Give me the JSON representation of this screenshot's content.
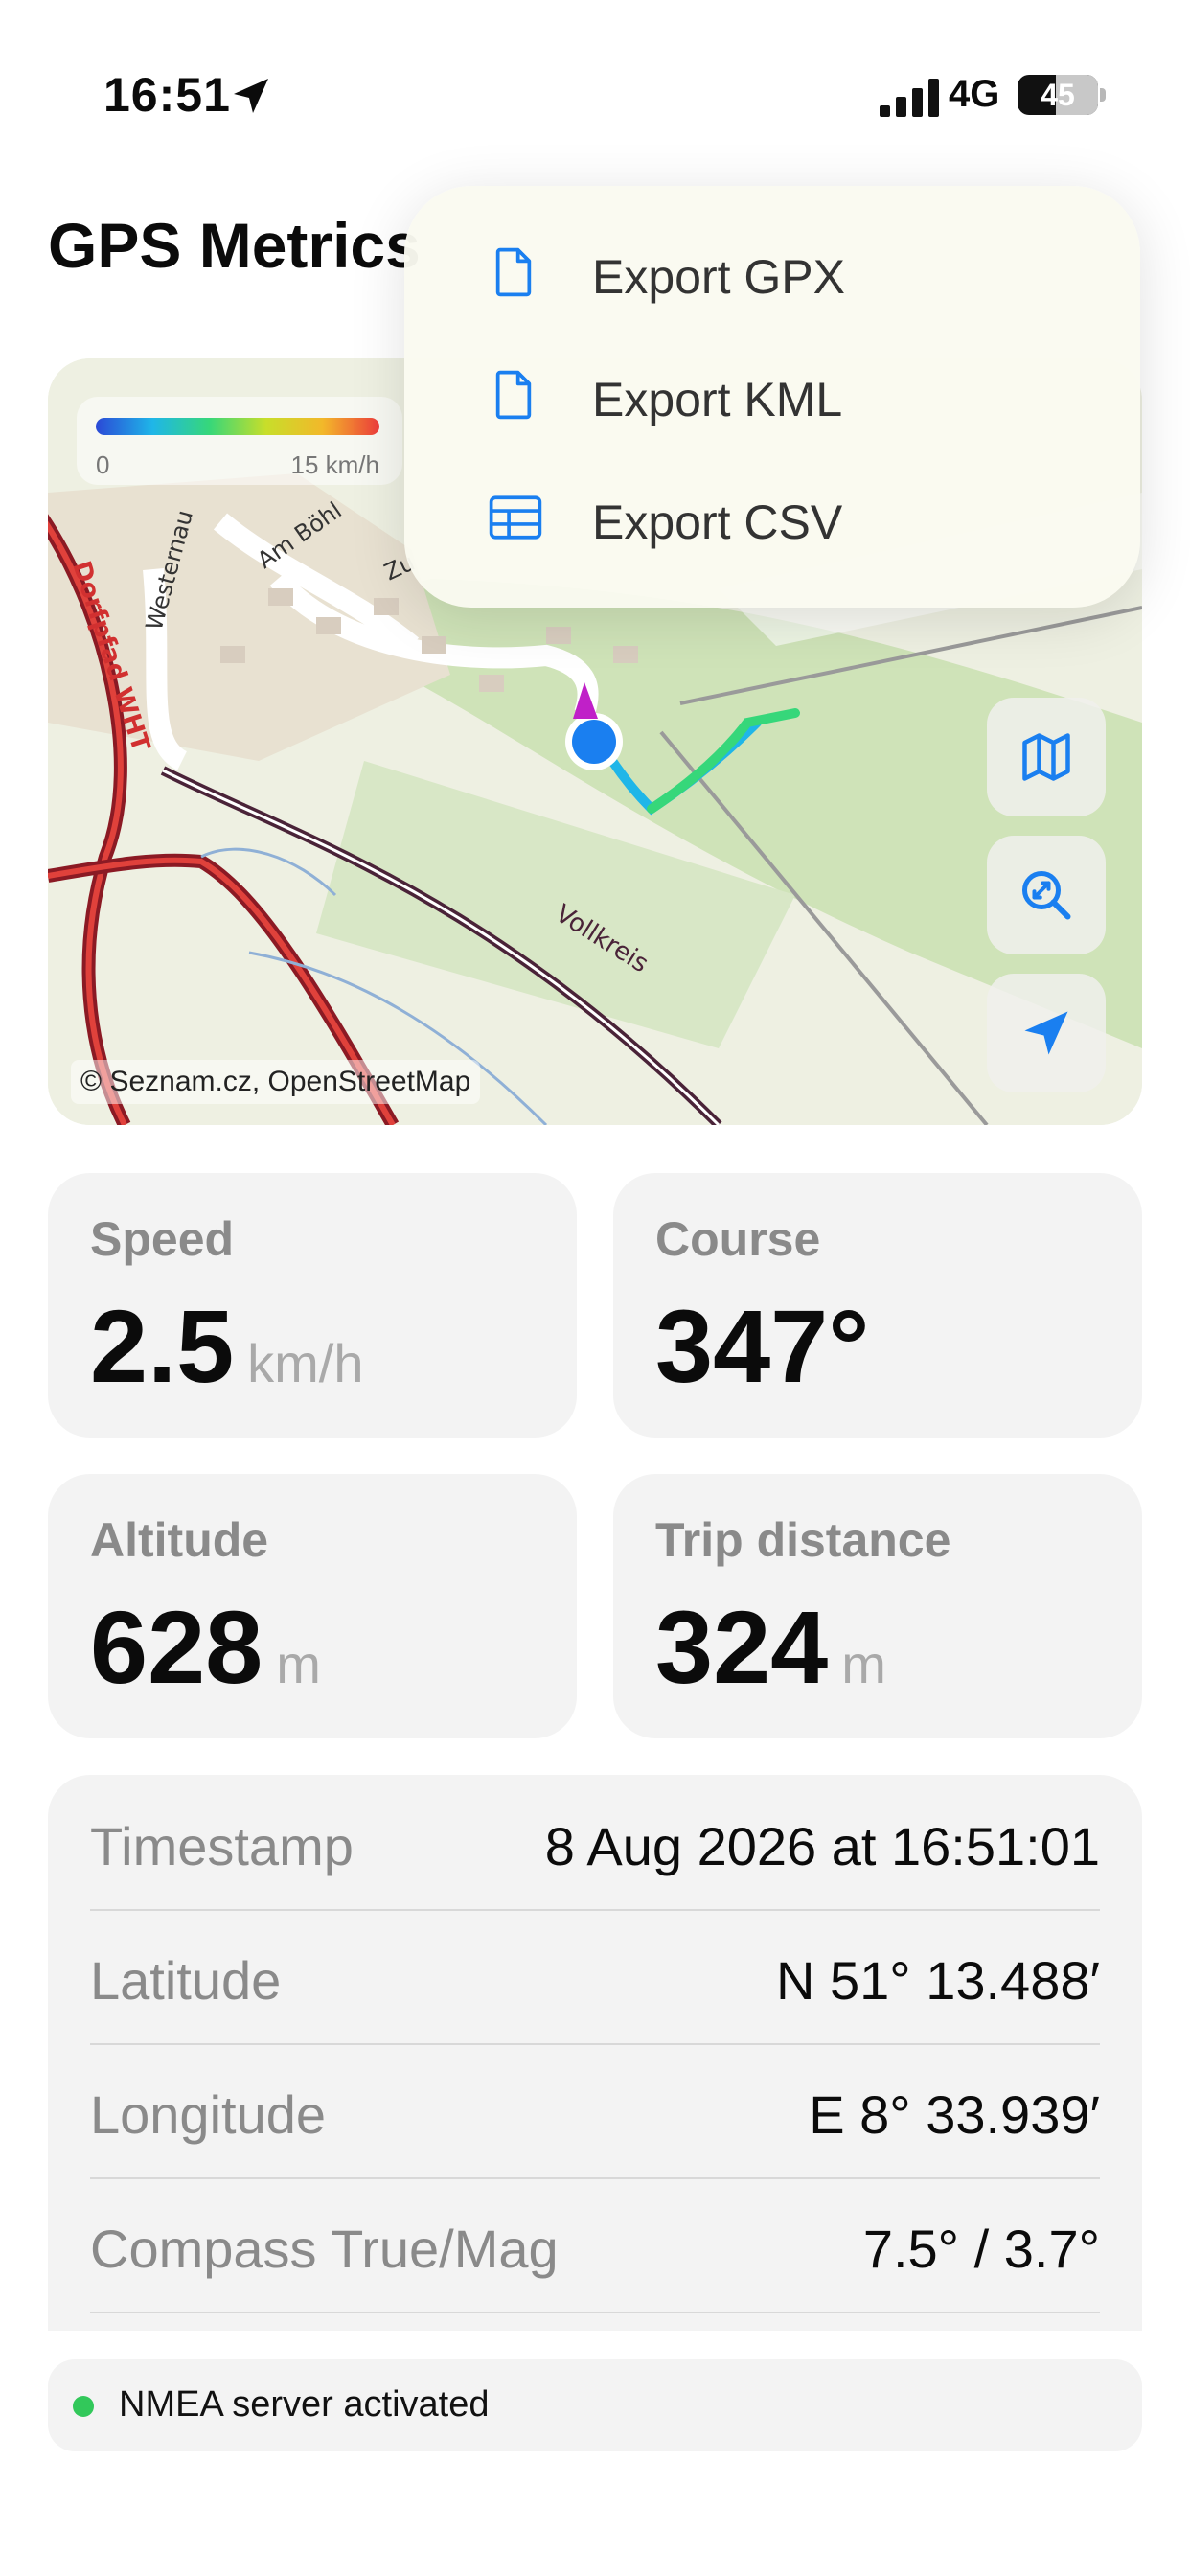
{
  "status_bar": {
    "time": "16:51",
    "network": "4G",
    "battery": "45"
  },
  "header": {
    "title": "GPS Metrics"
  },
  "map": {
    "legend": {
      "min": "0",
      "max": "15 km/h"
    },
    "labels": [
      "Dorfpfad WHT",
      "Westernau",
      "Am Böhl",
      "Zu",
      "Vollkreis"
    ],
    "attribution": "© Seznam.cz, OpenStreetMap"
  },
  "export_menu": {
    "gpx": "Export GPX",
    "kml": "Export KML",
    "csv": "Export CSV"
  },
  "metrics": {
    "speed": {
      "label": "Speed",
      "value": "2.5",
      "unit": "km/h"
    },
    "course": {
      "label": "Course",
      "value": "347°"
    },
    "altitude": {
      "label": "Altitude",
      "value": "628",
      "unit": "m"
    },
    "trip": {
      "label": "Trip distance",
      "value": "324",
      "unit": "m"
    }
  },
  "details": {
    "timestamp": {
      "label": "Timestamp",
      "value": "8 Aug 2026 at 16:51:01"
    },
    "latitude": {
      "label": "Latitude",
      "value": "N 51° 13.488′"
    },
    "longitude": {
      "label": "Longitude",
      "value": "E 8° 33.939′"
    },
    "compass": {
      "label": "Compass True/Mag",
      "value": "7.5° / 3.7°"
    }
  },
  "server_status": {
    "text": "NMEA server activated",
    "color": "#32c85a"
  },
  "icons": [
    "location-arrow-icon",
    "signal-icon",
    "battery-icon",
    "document-icon",
    "table-icon",
    "map-icon",
    "zoom-fit-icon",
    "navigate-icon"
  ]
}
